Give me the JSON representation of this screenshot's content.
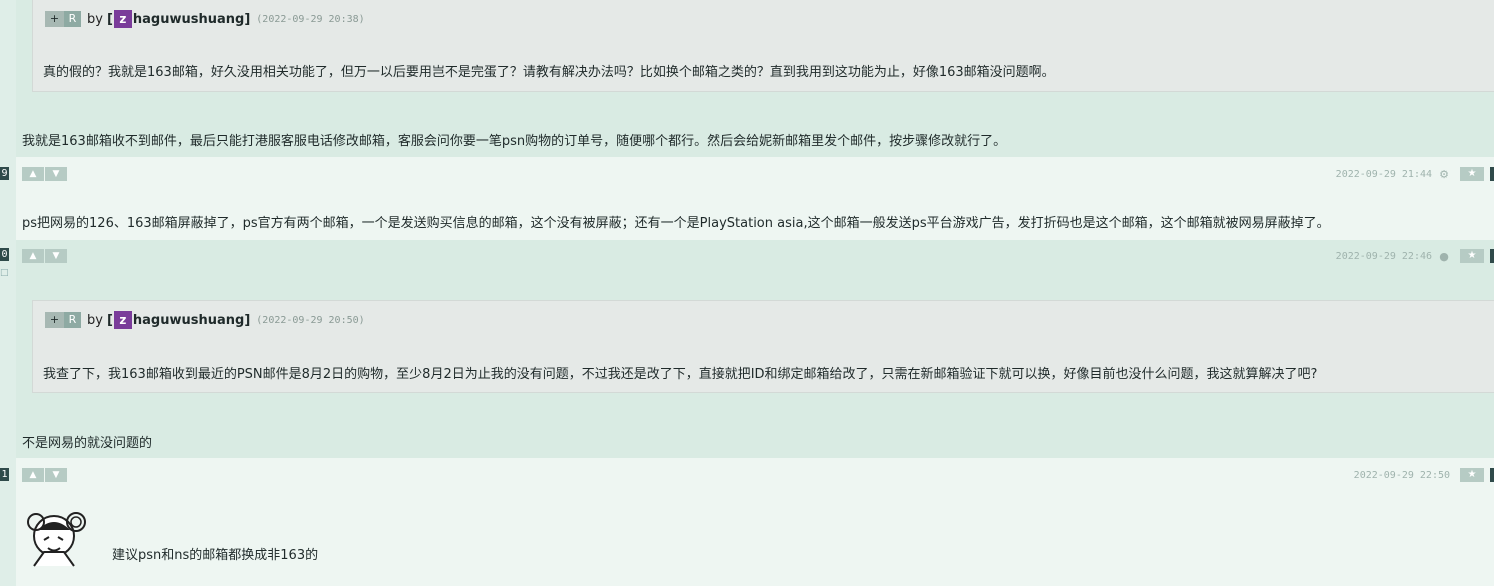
{
  "posts": [
    {
      "quote": {
        "plus": "+",
        "r": "R",
        "by": "by",
        "bracket": "[",
        "avatar_letter": "z",
        "username": "haguwushuang]",
        "date": "(2022-09-29 20:38)",
        "text": "真的假的？我就是163邮箱，好久没用相关功能了，但万一以后要用岂不是完蛋了？请教有解决办法吗？比如换个邮箱之类的？直到我用到这功能为止，好像163邮箱没问题啊。"
      },
      "text": "我就是163邮箱收不到邮件，最后只能打港服客服电话修改邮箱，客服会问你要一笔psn购物的订单号，随便哪个都行。然后会给妮新邮箱里发个邮件，按步骤修改就行了。"
    },
    {
      "floor": "9",
      "date": "2022-09-29 21:44",
      "os_icon": "android-icon",
      "text": "ps把网易的126、163邮箱屏蔽掉了，ps官方有两个邮箱，一个是发送购买信息的邮箱，这个没有被屏蔽；还有一个是PlayStation asia,这个邮箱一般发送ps平台游戏广告，发打折码也是这个邮箱，这个邮箱就被网易屏蔽掉了。"
    },
    {
      "floor": "0",
      "date": "2022-09-29 22:46",
      "os_icon": "apple-icon",
      "quote": {
        "plus": "+",
        "r": "R",
        "by": "by",
        "bracket": "[",
        "avatar_letter": "z",
        "username": "haguwushuang]",
        "date": "(2022-09-29 20:50)",
        "text": "我查了下，我163邮箱收到最近的PSN邮件是8月2日的购物，至少8月2日为止我的没有问题，不过我还是改了下，直接就把ID和绑定邮箱给改了，只需在新邮箱验证下就可以换，好像目前也没什么问题，我这就算解决了吧?"
      },
      "text": "不是网易的就没问题的"
    },
    {
      "floor": "1",
      "date": "2022-09-29 22:50",
      "text": "建议psn和ns的邮箱都换成非163的"
    }
  ],
  "buttons": {
    "upvote_icon": "thumbs-up-icon",
    "downvote_icon": "thumbs-down-icon",
    "star_icon": "star-icon"
  },
  "colors": {
    "accent_purple": "#7a3c9a",
    "post_dark": "#d9ebe3",
    "post_light": "#eef6f2",
    "floor_tag": "#2f4a4a"
  }
}
